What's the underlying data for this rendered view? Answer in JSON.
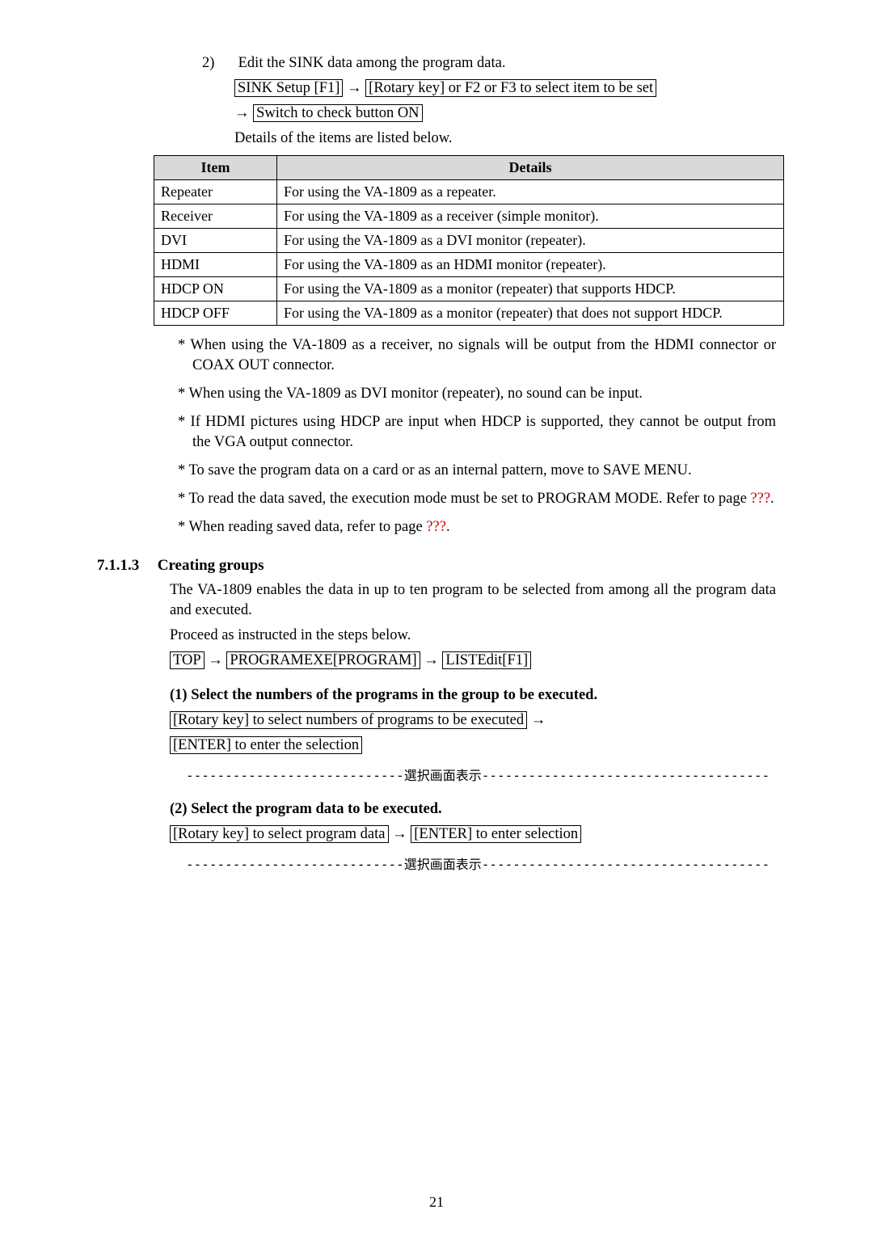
{
  "step2": {
    "num": "2)",
    "text": "Edit the SINK data among the program data.",
    "box1": "SINK Setup [F1]",
    "box2": "[Rotary key] or F2 or F3 to select item to be set",
    "box3": "Switch to check button ON",
    "details_intro": "Details of the items are listed below."
  },
  "table": {
    "headers": [
      "Item",
      "Details"
    ],
    "rows": [
      [
        "Repeater",
        "For using the VA-1809 as a repeater."
      ],
      [
        "Receiver",
        "For using the VA-1809 as a receiver (simple monitor)."
      ],
      [
        "DVI",
        "For using the VA-1809 as a DVI monitor (repeater)."
      ],
      [
        "HDMI",
        "For using the VA-1809 as an HDMI monitor (repeater)."
      ],
      [
        "HDCP ON",
        "For using the VA-1809 as a monitor (repeater) that supports HDCP."
      ],
      [
        "HDCP OFF",
        "For using the VA-1809 as a monitor (repeater) that does not support HDCP."
      ]
    ]
  },
  "notes": [
    "* When using the VA-1809 as a receiver, no signals will be output from the HDMI connector or COAX OUT connector.",
    "* When using the VA-1809 as DVI monitor (repeater), no sound can be input.",
    "* If HDMI pictures using HDCP are input when HDCP is supported, they cannot be output from the VGA output connector.",
    "* To save the program data on a card or as an internal pattern, move to SAVE MENU."
  ],
  "note5_a": "* To read the data saved, the execution mode must be set to PROGRAM MODE. Refer to page ",
  "note5_b": "???",
  "note5_c": ".",
  "note6_a": "* When reading saved data, refer to page ",
  "note6_b": "???",
  "note6_c": ".",
  "sec": {
    "num": "7.1.1.3",
    "title": "Creating groups",
    "para1": "The VA-1809 enables the data in up to ten program to be selected from among all the program data and executed.",
    "para2": "Proceed as instructed in the steps below.",
    "nav1": "TOP",
    "nav2": "PROGRAMEXE[PROGRAM]",
    "nav3": "LISTEdit[F1]"
  },
  "sub1": {
    "head": "(1)  Select the numbers of the programs in the group to be executed.",
    "box1": "[Rotary key] to select numbers of programs to be executed",
    "box2": "[ENTER] to enter the selection"
  },
  "sep": "----------------------------選択画面表示-------------------------------------",
  "sub2": {
    "head": "(2)  Select the program data to be executed.",
    "box1": "[Rotary key] to select program data",
    "box2": "[ENTER] to enter selection"
  },
  "pagenum": "21",
  "arrow": "→"
}
